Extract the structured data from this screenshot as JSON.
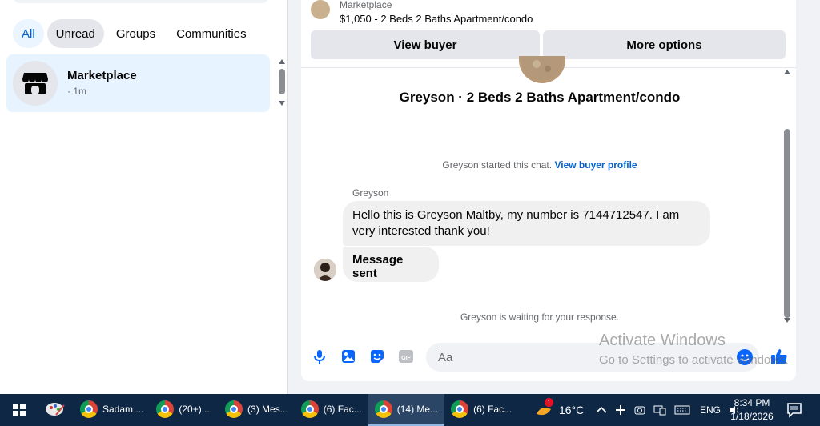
{
  "sidebar": {
    "filters": [
      {
        "label": "All"
      },
      {
        "label": "Unread"
      },
      {
        "label": "Groups"
      },
      {
        "label": "Communities"
      }
    ],
    "conversation": {
      "name": "Marketplace",
      "time": "· 1m"
    }
  },
  "chat": {
    "listing_name": "Marketplace",
    "listing_title": "$1,050 - 2 Beds 2 Baths Apartment/condo",
    "view_buyer_label": "View buyer",
    "more_options_label": "More options",
    "title": "Greyson · 2 Beds 2 Baths Apartment/condo",
    "info_text": "Greyson started this chat.",
    "info_link": "View buyer profile",
    "sender_name": "Greyson",
    "message1": "Hello this is Greyson Maltby, my number is 7144712547. I am very interested thank you!",
    "message2": "Message sent",
    "waiting_text": "Greyson is waiting for your response.",
    "composer_placeholder": "Aa"
  },
  "watermark": {
    "title": "Activate Windows",
    "subtitle": "Go to Settings to activate Windows."
  },
  "taskbar": {
    "apps": [
      {
        "label": "Sadam ..."
      },
      {
        "label": "(20+) ..."
      },
      {
        "label": "(3) Mes..."
      },
      {
        "label": "(6) Fac..."
      },
      {
        "label": "(14) Me..."
      },
      {
        "label": "(6) Fac..."
      }
    ],
    "weather_badge": "1",
    "temperature": "16°C",
    "language": "ENG",
    "time": "8:34 PM",
    "date": "1/18/2026"
  },
  "colors": {
    "accent": "#0064d1",
    "messenger_blue": "#0866ff",
    "taskbar": "#0e2745"
  }
}
